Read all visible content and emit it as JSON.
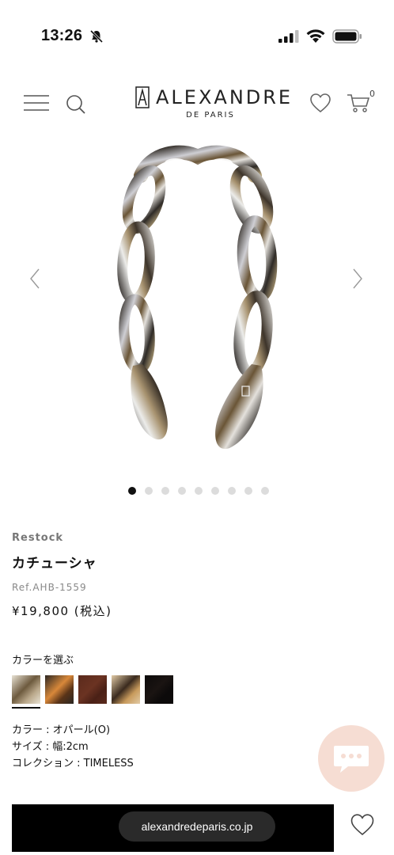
{
  "status_bar": {
    "time": "13:26"
  },
  "header": {
    "brand_name": "ALEXANDRE",
    "brand_sub": "DE PARIS",
    "cart_count": "0"
  },
  "gallery": {
    "image_count": 9,
    "active_index": 0
  },
  "product": {
    "label": "Restock",
    "name": "カチューシャ",
    "ref": "Ref.AHB-1559",
    "price": "¥19,800 (税込)"
  },
  "color_selector": {
    "title": "カラーを選ぶ",
    "swatches": [
      {
        "name": "opal",
        "selected": true,
        "colors": [
          "#e8e2d4",
          "#6d5a3e",
          "#b9a78a"
        ]
      },
      {
        "name": "tortoise-dark",
        "selected": false,
        "colors": [
          "#2a2622",
          "#d8883a",
          "#5a3418"
        ]
      },
      {
        "name": "brown",
        "selected": false,
        "colors": [
          "#5a2a1c",
          "#6b3322",
          "#4a2016"
        ]
      },
      {
        "name": "tortoise-light",
        "selected": false,
        "colors": [
          "#e2cba6",
          "#3a2a1e",
          "#c89a5c"
        ]
      },
      {
        "name": "black",
        "selected": false,
        "colors": [
          "#0c0a0a",
          "#1a1412",
          "#0c0a0a"
        ]
      }
    ]
  },
  "specs": {
    "color": "カラー : オパール(O)",
    "size": "サイズ : 幅:2cm",
    "collection": "コレクション : TIMELESS"
  },
  "browser": {
    "url": "alexandredeparis.co.jp"
  },
  "colors": {
    "accent": "#000000",
    "chat_bg": "#f6ddd3",
    "dot_inactive": "#dcdcdc"
  }
}
